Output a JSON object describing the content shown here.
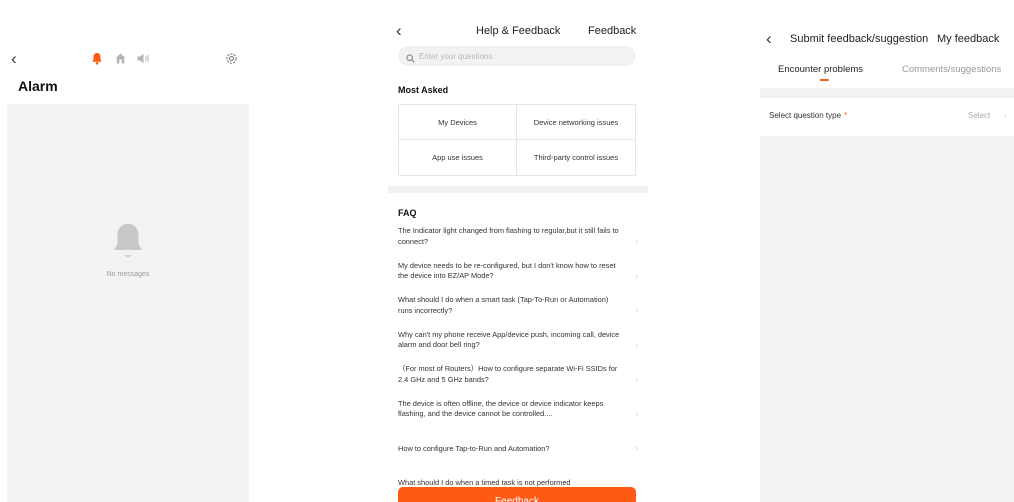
{
  "alarm_screen": {
    "title": "Alarm",
    "empty_text": "No messages",
    "icons": {
      "back": "chevron-left-icon",
      "tabs": [
        "bell-icon",
        "home-icon",
        "speaker-icon"
      ],
      "settings": "gear-icon"
    },
    "active_tab_color": "#ff5a14"
  },
  "help_screen": {
    "back_label": "<",
    "title": "Help & Feedback",
    "feedback_link": "Feedback",
    "search": {
      "placeholder": "Enter your questions",
      "value": ""
    },
    "most_asked": {
      "title": "Most Asked",
      "items": [
        "My Devices",
        "Device networking issues",
        "App use issues",
        "Third-party control issues"
      ]
    },
    "faq": {
      "title": "FAQ",
      "items": [
        "The Indicator light changed from flashing to regular,but it still fails to connect?",
        "My device needs to be re-configured, but I don't know how to reset the device into EZ/AP Mode?",
        "What should I do when a smart task (Tap-To-Run or Automation) runs incorrectly?",
        "Why can't my phone receive App/device push, incoming call, device alarm and door bell ring?",
        "（For most of Routers）How to configure separate Wi-Fi SSIDs for 2.4 GHz and 5 GHz bands?",
        "The device is often offline, the device or device indicator keeps flashing, and the device cannot be controlled....",
        "How to configure Tap-to-Run and Automation?",
        "What should I do when a timed task is not performed"
      ]
    },
    "feedback_button": "Feedback",
    "accent_color": "#ff5a14"
  },
  "feedback_screen": {
    "title": "Submit feedback/suggestion",
    "my_feedback_link": "My feedback",
    "tabs": [
      "Encounter problems",
      "Comments/suggestions"
    ],
    "active_tab": "Encounter problems",
    "question_type": {
      "label": "Select question type",
      "required_mark": "*",
      "value": "Select"
    }
  }
}
